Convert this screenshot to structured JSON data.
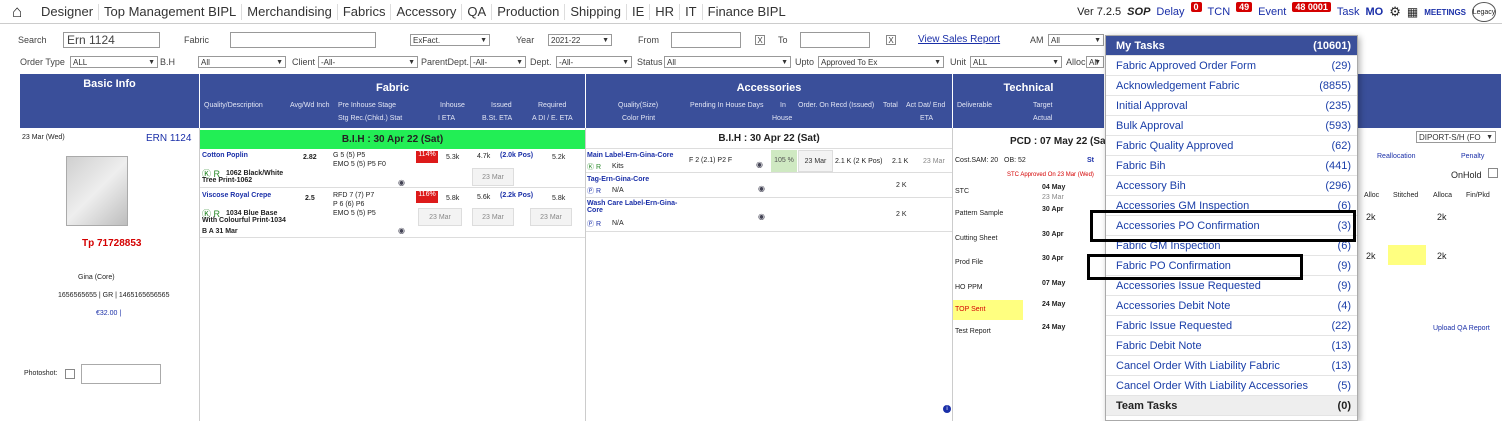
{
  "menu": [
    "Designer",
    "Top Management BIPL",
    "Merchandising",
    "Fabrics",
    "Accessory",
    "QA",
    "Production",
    "Shipping",
    "IE",
    "HR",
    "IT",
    "Finance BIPL"
  ],
  "tools": {
    "version": "Ver 7.2.5",
    "sop": "SOP",
    "delay": "Delay",
    "tcn": "TCN",
    "event": "Event",
    "task": "Task",
    "mo": "MO",
    "meetings": "MEETINGS",
    "legacy": "Legacy",
    "badge1": "0",
    "badge2": "49",
    "badge3": "48 0001"
  },
  "filters": {
    "search_label": "Search",
    "search_value": "Ern 1124",
    "fabric_label": "Fabric",
    "exfact": "ExFact.",
    "year_label": "Year",
    "year_value": "2021-22",
    "from_label": "From",
    "to_label": "To",
    "view_sales_report": "View Sales Report",
    "am_label": "AM",
    "am_value": "All",
    "order_type_label": "Order Type",
    "order_type_value": "ALL",
    "bh_label": "B.H",
    "bh_value": "All",
    "client_label": "Client",
    "client_value": "-All-",
    "parentdept_label": "ParentDept.",
    "parentdept_value": "-All-",
    "dept_label": "Dept.",
    "dept_value": "-All-",
    "status_label": "Status",
    "status_value": "All",
    "upto_label": "Upto",
    "upto_value": "Approved To Ex",
    "unit_label": "Unit",
    "unit_value": "ALL",
    "alloc_label": "Alloc.",
    "alloc_value": "All",
    "x": "X"
  },
  "headers": {
    "basic": "Basic Info",
    "fabric": "Fabric",
    "accessories": "Accessories",
    "technical": "Technical",
    "fabric_sub": [
      "Quality/Description",
      "Avg/Wd Inch",
      "Pre Inhouse Stage",
      "Stg Rec.(Chkd.) Stat",
      "Inhouse",
      "I ETA",
      "Issued",
      "B.St. ETA",
      "Required",
      "A DI / E. ETA"
    ],
    "acc_sub": [
      "Quality(Size)",
      "Color Print",
      "Pending In House Days",
      "In",
      "House",
      "Order. On Recd (Issued)",
      "Total",
      "Act Dat/ End",
      "ETA"
    ],
    "tech_sub": [
      "Deliverable",
      "Target",
      "Actual"
    ]
  },
  "basic": {
    "date": "23 Mar (Wed)",
    "ern": "ERN 1124",
    "tp": "Tp 71728853",
    "client": "Gina (Core)",
    "codes": "1656565655 | GR | 1465165656565",
    "price": "€32.00 |",
    "photoshot": "Photoshot:"
  },
  "fabric": {
    "bih": "B.I.H : 30 Apr 22 (Sat)",
    "rows": [
      {
        "name": "Cotton Poplin",
        "avg": "2.82",
        "stage1": "G 5 (5) P5",
        "stage2": "EMO 5 (5) P5 F0",
        "pct": "114%",
        "inhouse": "5.3k",
        "issued": "4.7k",
        "pos": "(2.0k Pos)",
        "required": "5.2k",
        "color": "1062 Black/White Tree Print-1062",
        "eta": "23 Mar"
      },
      {
        "name": "Viscose Royal Crepe",
        "avg": "2.5",
        "stage1": "RFD 7 (7) P7",
        "stage2": "P 6 (6) P6",
        "stage3": "EMO 5 (5) P5",
        "pct": "116%",
        "inhouse": "5.8k",
        "issued": "5.6k",
        "pos": "(2.2k Pos)",
        "required": "5.8k",
        "color": "1034 Blue Base With Colourful Print-1034",
        "ba": "B A 31 Mar",
        "eta": "23 Mar"
      }
    ]
  },
  "accessories": {
    "bih": "B.I.H : 30 Apr 22 (Sat)",
    "rows": [
      {
        "name": "Main Label-Ern-Gina-Core",
        "sub": "Kits",
        "pending": "F 2 (2.1) P2 F",
        "pct": "105 %",
        "date": "23 Mar",
        "recd": "2.1 K (2 K Pos)",
        "total": "2.1 K",
        "eta": "23 Mar"
      },
      {
        "name": "Tag-Ern-Gina-Core",
        "sub": "N/A",
        "total": "2 K"
      },
      {
        "name": "Wash Care Label-Ern-Gina-Core",
        "sub": "N/A",
        "total": "2 K"
      }
    ]
  },
  "technical": {
    "pcd": "PCD : 07 May 22 (Sat)",
    "cost": "Cost.SAM: 20",
    "ob": "OB: 52",
    "st": "St",
    "stc_approved": "STC Approved On 23 Mar (Wed)",
    "rows": [
      {
        "name": "STC",
        "target": "04 May",
        "actual": "23 Mar"
      },
      {
        "name": "Pattern Sample",
        "target": "30 Apr"
      },
      {
        "name": "Cutting Sheet",
        "target": "30 Apr"
      },
      {
        "name": "Prod File",
        "target": "30 Apr"
      },
      {
        "name": "HO PPM",
        "target": "07 May"
      },
      {
        "name": "TOP Sent",
        "target": "24 May"
      },
      {
        "name": "Test Report",
        "target": "24 May"
      }
    ]
  },
  "right": {
    "dropdown": "DIPORT-S/H (FO",
    "reallocation": "Reallocation",
    "penalty": "Penalty",
    "onhold": "OnHold",
    "cols": [
      "Alloc",
      "Stitched",
      "Alloca",
      "Fin/Pkd"
    ],
    "vals": [
      "2k",
      "2k",
      "2k",
      "2k"
    ],
    "upload": "Upload QA Report"
  },
  "tasks": {
    "title": "My Tasks",
    "total": "(10601)",
    "items": [
      {
        "label": "Fabric Approved Order Form",
        "count": "(29)"
      },
      {
        "label": "Acknowledgement Fabric",
        "count": "(8855)"
      },
      {
        "label": "Initial Approval",
        "count": "(235)"
      },
      {
        "label": "Bulk Approval",
        "count": "(593)"
      },
      {
        "label": "Fabric Quality Approved",
        "count": "(62)"
      },
      {
        "label": "Fabric Bih",
        "count": "(441)"
      },
      {
        "label": "Accessory Bih",
        "count": "(296)"
      },
      {
        "label": "Accessories GM Inspection",
        "count": "(6)"
      },
      {
        "label": "Accessories PO Confirmation",
        "count": "(3)"
      },
      {
        "label": "Fabric GM Inspection",
        "count": "(6)"
      },
      {
        "label": "Fabric PO Confirmation",
        "count": "(9)"
      },
      {
        "label": "Accessories Issue Requested",
        "count": "(9)"
      },
      {
        "label": "Accessories Debit Note",
        "count": "(4)"
      },
      {
        "label": "Fabric Issue Requested",
        "count": "(22)"
      },
      {
        "label": "Fabric Debit Note",
        "count": "(13)"
      },
      {
        "label": "Cancel Order With Liability Fabric",
        "count": "(13)"
      },
      {
        "label": "Cancel Order With Liability Accessories",
        "count": "(5)"
      }
    ],
    "team": "Team Tasks",
    "team_count": "(0)"
  }
}
